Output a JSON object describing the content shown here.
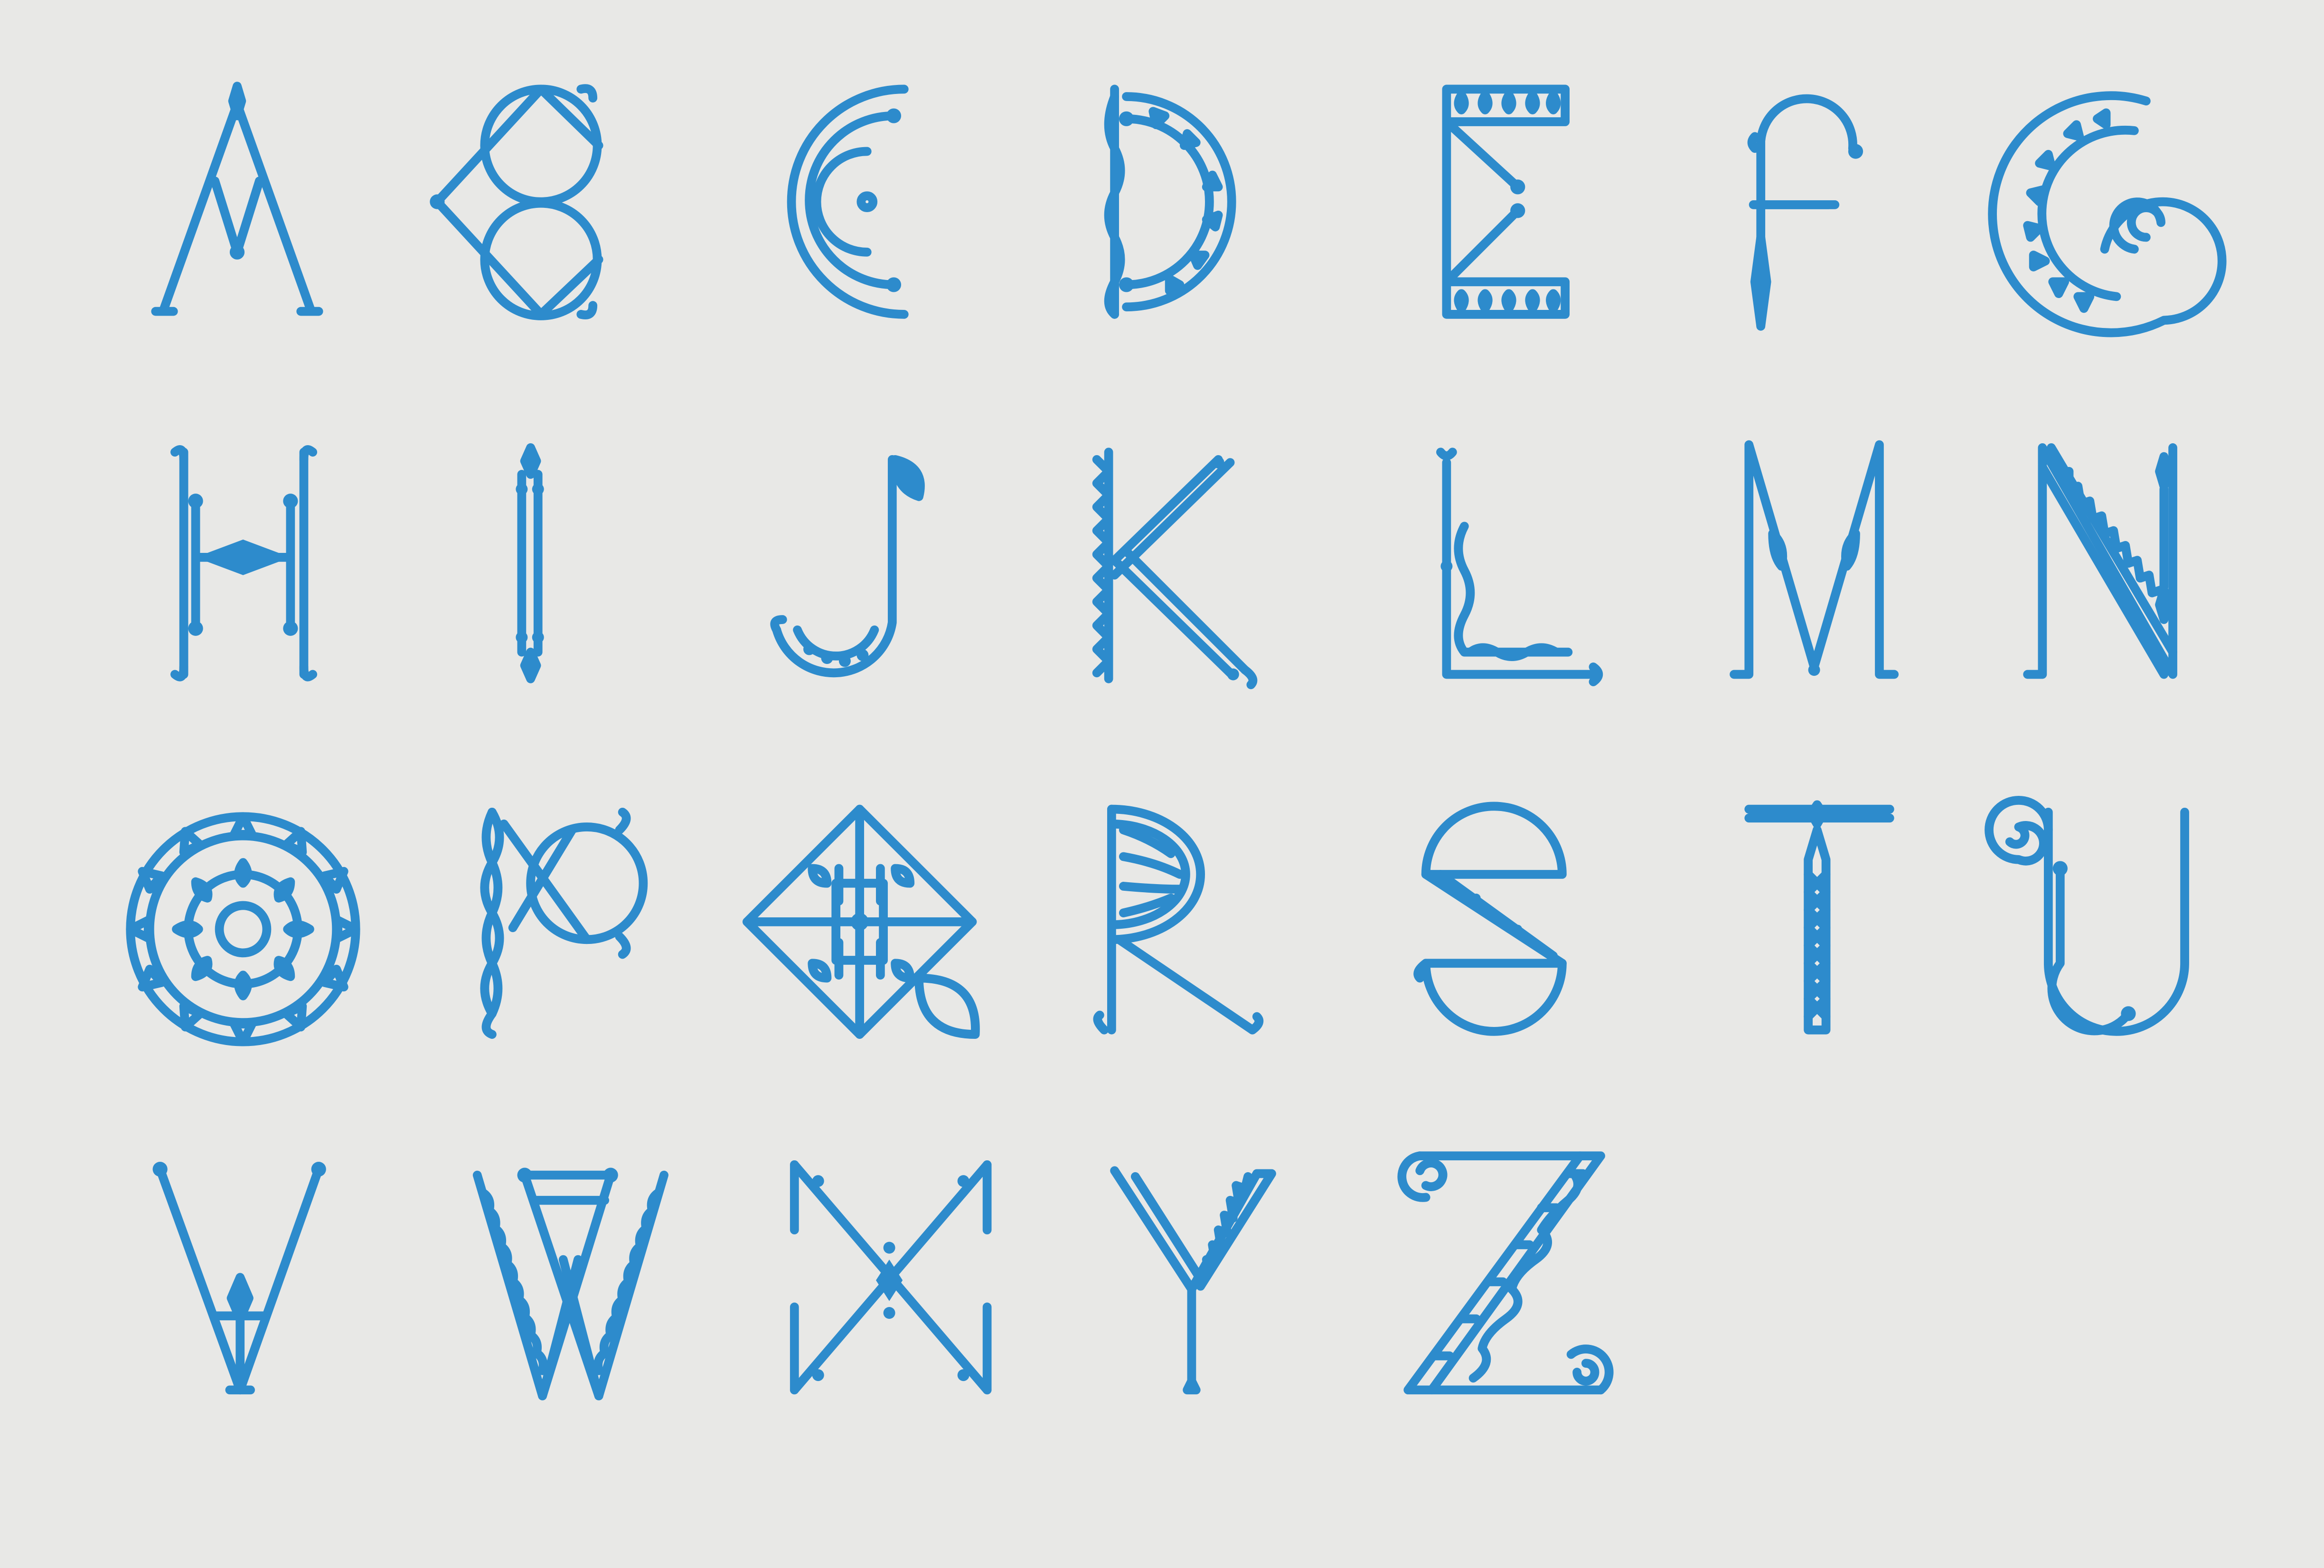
{
  "colors": {
    "background": "#e8e8e6",
    "ink": "#2d8bcc"
  },
  "alphabet": {
    "glyphs": [
      {
        "letter": "A",
        "icon": "ornamental-letter-a"
      },
      {
        "letter": "B",
        "icon": "ornamental-letter-b"
      },
      {
        "letter": "C",
        "icon": "ornamental-letter-c"
      },
      {
        "letter": "D",
        "icon": "ornamental-letter-d"
      },
      {
        "letter": "E",
        "icon": "ornamental-letter-e"
      },
      {
        "letter": "F",
        "icon": "ornamental-letter-f"
      },
      {
        "letter": "G",
        "icon": "ornamental-letter-g"
      },
      {
        "letter": "H",
        "icon": "ornamental-letter-h"
      },
      {
        "letter": "I",
        "icon": "ornamental-letter-i"
      },
      {
        "letter": "J",
        "icon": "ornamental-letter-j"
      },
      {
        "letter": "K",
        "icon": "ornamental-letter-k"
      },
      {
        "letter": "L",
        "icon": "ornamental-letter-l"
      },
      {
        "letter": "M",
        "icon": "ornamental-letter-m"
      },
      {
        "letter": "N",
        "icon": "ornamental-letter-n"
      },
      {
        "letter": "O",
        "icon": "ornamental-letter-o"
      },
      {
        "letter": "P",
        "icon": "ornamental-letter-p"
      },
      {
        "letter": "Q",
        "icon": "ornamental-letter-q"
      },
      {
        "letter": "R",
        "icon": "ornamental-letter-r"
      },
      {
        "letter": "S",
        "icon": "ornamental-letter-s"
      },
      {
        "letter": "T",
        "icon": "ornamental-letter-t"
      },
      {
        "letter": "U",
        "icon": "ornamental-letter-u"
      },
      {
        "letter": "V",
        "icon": "ornamental-letter-v"
      },
      {
        "letter": "W",
        "icon": "ornamental-letter-w"
      },
      {
        "letter": "X",
        "icon": "ornamental-letter-x"
      },
      {
        "letter": "Y",
        "icon": "ornamental-letter-y"
      },
      {
        "letter": "Z",
        "icon": "ornamental-letter-z"
      }
    ]
  }
}
